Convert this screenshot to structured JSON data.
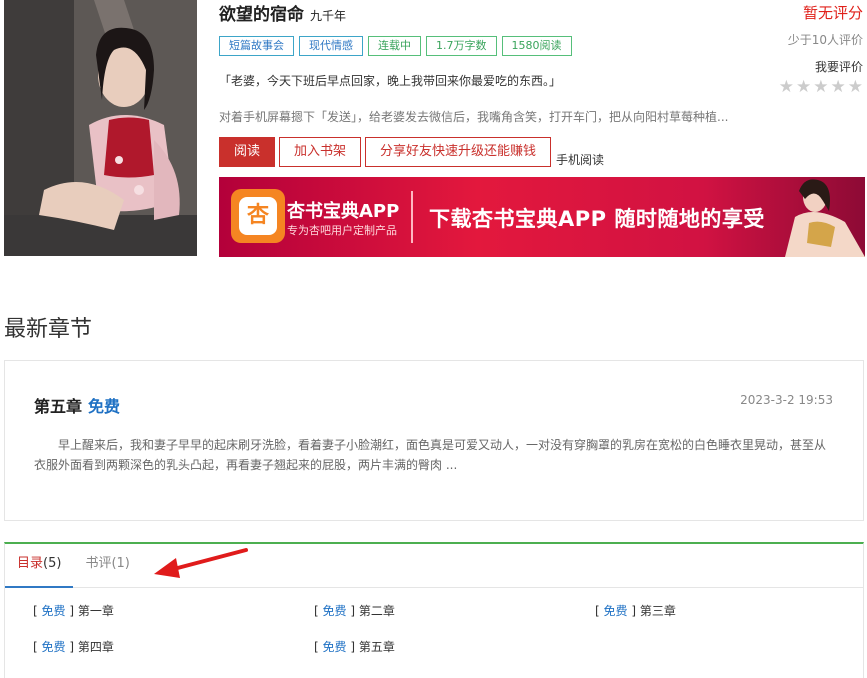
{
  "book": {
    "title": "欲望的宿命",
    "author": "九千年",
    "tags": [
      {
        "label": "短篇故事会",
        "color": "blue"
      },
      {
        "label": "现代情感",
        "color": "blue"
      },
      {
        "label": "连载中",
        "color": "green"
      },
      {
        "label": "1.7万字数",
        "color": "green"
      },
      {
        "label": "1580阅读",
        "color": "green"
      }
    ],
    "quote": "「老婆，今天下班后早点回家，晚上我带回来你最爱吃的东西。」",
    "intro": "对着手机屏幕摁下「发送」，给老婆发去微信后，我嘴角含笑，打开车门，把从向阳村草莓种植...",
    "buttons": {
      "read": "阅读",
      "add_shelf": "加入书架",
      "share": "分享好友快速升级还能赚钱",
      "mobile_read": "手机阅读"
    }
  },
  "rating": {
    "score_text": "暂无评分",
    "count_text": "少于10人评价",
    "action_text": "我要评价",
    "stars_total": 5
  },
  "banner": {
    "logo_char": "杏",
    "app_name": "杏书宝典APP",
    "app_sub": "专为杏吧用户定制产品",
    "slogan": "下载杏书宝典APP 随时随地的享受"
  },
  "latest": {
    "section_title": "最新章节",
    "chapter_name": "第五章",
    "chapter_free": "免费",
    "date": "2023-3-2 19:53",
    "excerpt": "早上醒来后，我和妻子早早的起床刷牙洗脸，看着妻子小脸潮红，面色真是可爱又动人，一对没有穿胸罩的乳房在宽松的白色睡衣里晃动，甚至从衣服外面看到两颗深色的乳头凸起，再看妻子翘起来的屁股，两片丰满的臀肉 ..."
  },
  "tabs": [
    {
      "label": "目录",
      "count": "(5)",
      "active": true
    },
    {
      "label": "书评",
      "count": "(1)",
      "active": false
    }
  ],
  "chapters": [
    {
      "free": "免费",
      "name": "第一章"
    },
    {
      "free": "免费",
      "name": "第二章"
    },
    {
      "free": "免费",
      "name": "第三章"
    },
    {
      "free": "免费",
      "name": "第四章"
    },
    {
      "free": "免费",
      "name": "第五章"
    }
  ],
  "colors": {
    "accent_red": "#c9302c",
    "link_blue": "#1f71c4",
    "tab_green": "#4caf50"
  }
}
